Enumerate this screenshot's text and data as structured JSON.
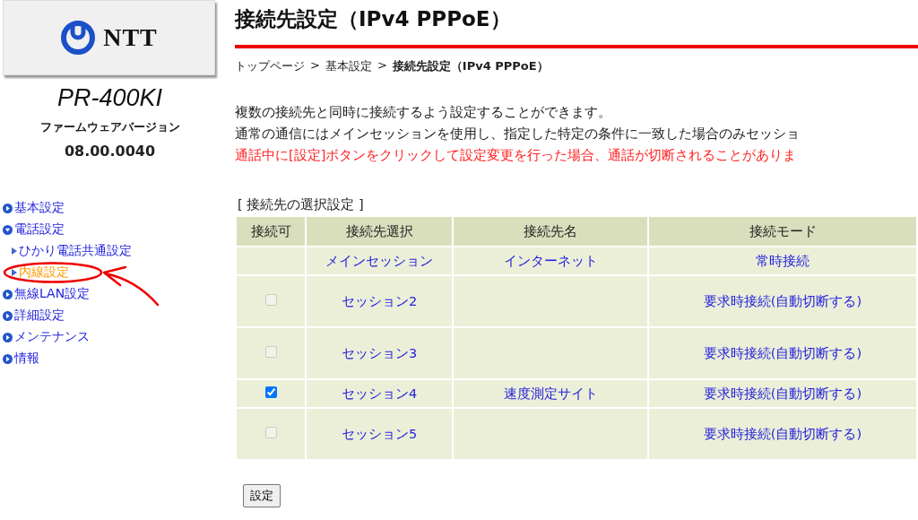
{
  "sidebar": {
    "logo": {
      "text": "NTT"
    },
    "model": "PR-400KI",
    "firmware_label": "ファームウェアバージョン",
    "firmware_version": "08.00.0040",
    "nav": [
      {
        "label": "基本設定",
        "expanded": false,
        "selected": false
      },
      {
        "label": "電話設定",
        "expanded": true,
        "selected": false,
        "children": [
          {
            "label": "ひかり電話共通設定",
            "selected": false
          },
          {
            "label": "内線設定",
            "selected": true
          }
        ]
      },
      {
        "label": "無線LAN設定",
        "expanded": false,
        "selected": false
      },
      {
        "label": "詳細設定",
        "expanded": false,
        "selected": false
      },
      {
        "label": "メンテナンス",
        "expanded": false,
        "selected": false
      },
      {
        "label": "情報",
        "expanded": false,
        "selected": false
      }
    ]
  },
  "main": {
    "title": "接続先設定（IPv4 PPPoE）",
    "breadcrumb": [
      {
        "label": "トップページ",
        "current": false
      },
      {
        "label": "基本設定",
        "current": false
      },
      {
        "label": "接続先設定（IPv4 PPPoE）",
        "current": true
      }
    ],
    "breadcrumb_separator": ">",
    "description": [
      {
        "text": "複数の接続先と同時に接続するよう設定することができます。",
        "kind": "normal"
      },
      {
        "text": "通常の通信にはメインセッションを使用し、指定した特定の条件に一致した場合のみセッショ",
        "kind": "normal"
      },
      {
        "text": "通話中に[設定]ボタンをクリックして設定変更を行った場合、通話が切断されることがありま",
        "kind": "warning"
      }
    ],
    "table": {
      "caption": "[ 接続先の選択設定 ]",
      "columns": [
        "接続可",
        "接続先選択",
        "接続先名",
        "接続モード"
      ],
      "rows": [
        {
          "checkbox": null,
          "selection": "メインセッション",
          "name": "インターネット",
          "mode": "常時接続",
          "tall": false
        },
        {
          "checkbox": {
            "checked": false,
            "disabled": true
          },
          "selection": "セッション2",
          "mode": "要求時接続(自動切断する)",
          "tall": true
        },
        {
          "checkbox": {
            "checked": false,
            "disabled": true
          },
          "selection": "セッション3",
          "mode": "要求時接続(自動切断する)",
          "tall": true
        },
        {
          "checkbox": {
            "checked": true,
            "disabled": false
          },
          "selection": "セッション4",
          "name": "速度測定サイト",
          "mode": "要求時接続(自動切断する)",
          "tall": false
        },
        {
          "checkbox": {
            "checked": false,
            "disabled": true
          },
          "selection": "セッション5",
          "mode": "要求時接続(自動切断する)",
          "tall": true
        }
      ]
    },
    "submit_button": "設定"
  }
}
